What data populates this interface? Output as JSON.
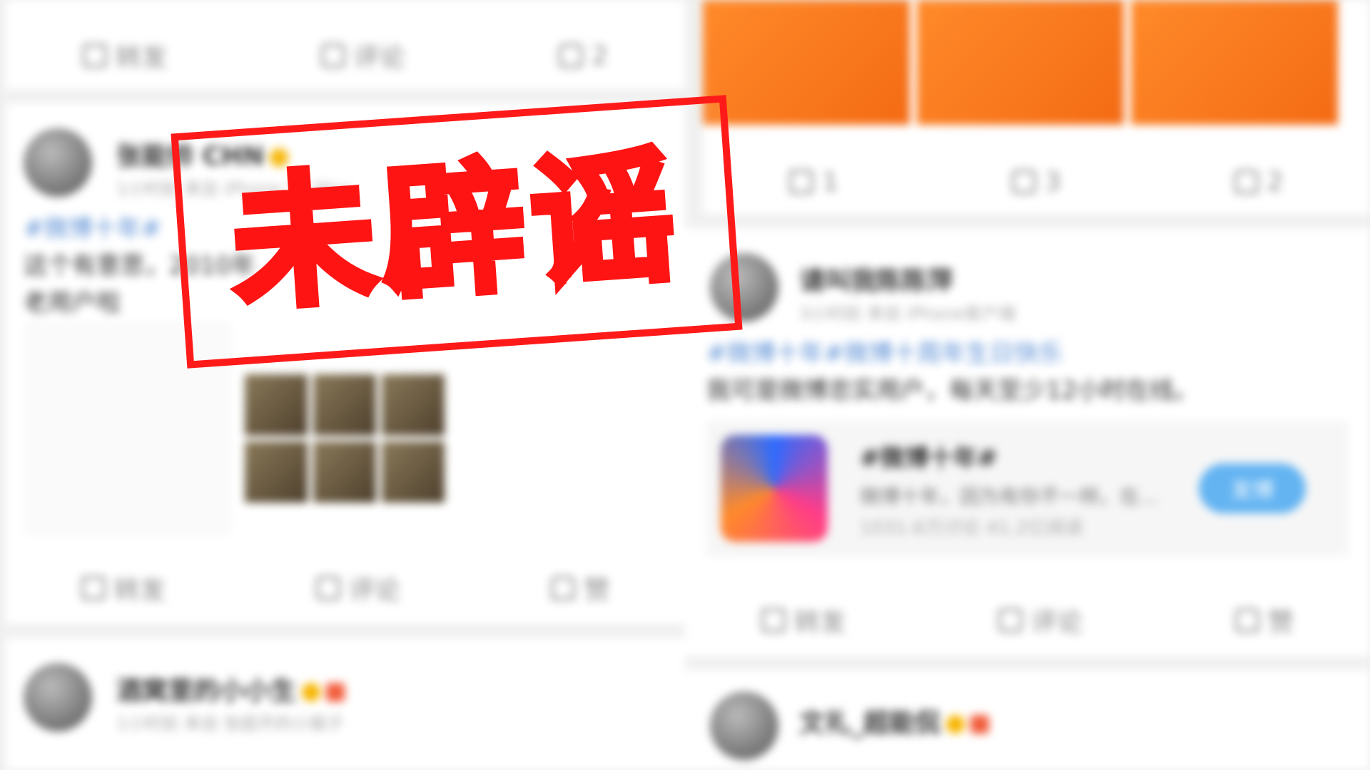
{
  "stamp": {
    "text": "未辟谣",
    "color": "#ff1414"
  },
  "left": {
    "top_actions": {
      "repost": "转发",
      "comment": "评论",
      "like_count": "2"
    },
    "post": {
      "user": "张能帅 CHN",
      "meta": "1小时前 来自 iPhone XS Max",
      "hashtag": "#微博十年#",
      "text_line1": "这个有意思，2010年",
      "text_line2": "老用户啦",
      "actions": {
        "repost": "转发",
        "comment": "评论",
        "like": "赞"
      }
    },
    "post2": {
      "user": "酒窝里的小小生",
      "meta": "1小时前 来自 张庭开的小猴子"
    }
  },
  "right": {
    "top_actions": {
      "repost": "1",
      "comment": "3",
      "like": "2"
    },
    "post": {
      "user": "请叫我陈陈萍",
      "meta": "3小时前 来自 iPhone客户端",
      "hashtag": "#微博十年#微博十周年生日快乐",
      "text": "我可是微博忠实用户，每天至少12小时在线。",
      "topic": {
        "title": "#微博十年#",
        "desc": "微博十年，因为有你不一样。在...",
        "stats": "1031.6万讨论  41.2亿阅读",
        "button": "发博"
      },
      "actions": {
        "repost": "转发",
        "comment": "评论",
        "like": "赞"
      }
    },
    "post2": {
      "user": "文礼_超能侃"
    }
  }
}
